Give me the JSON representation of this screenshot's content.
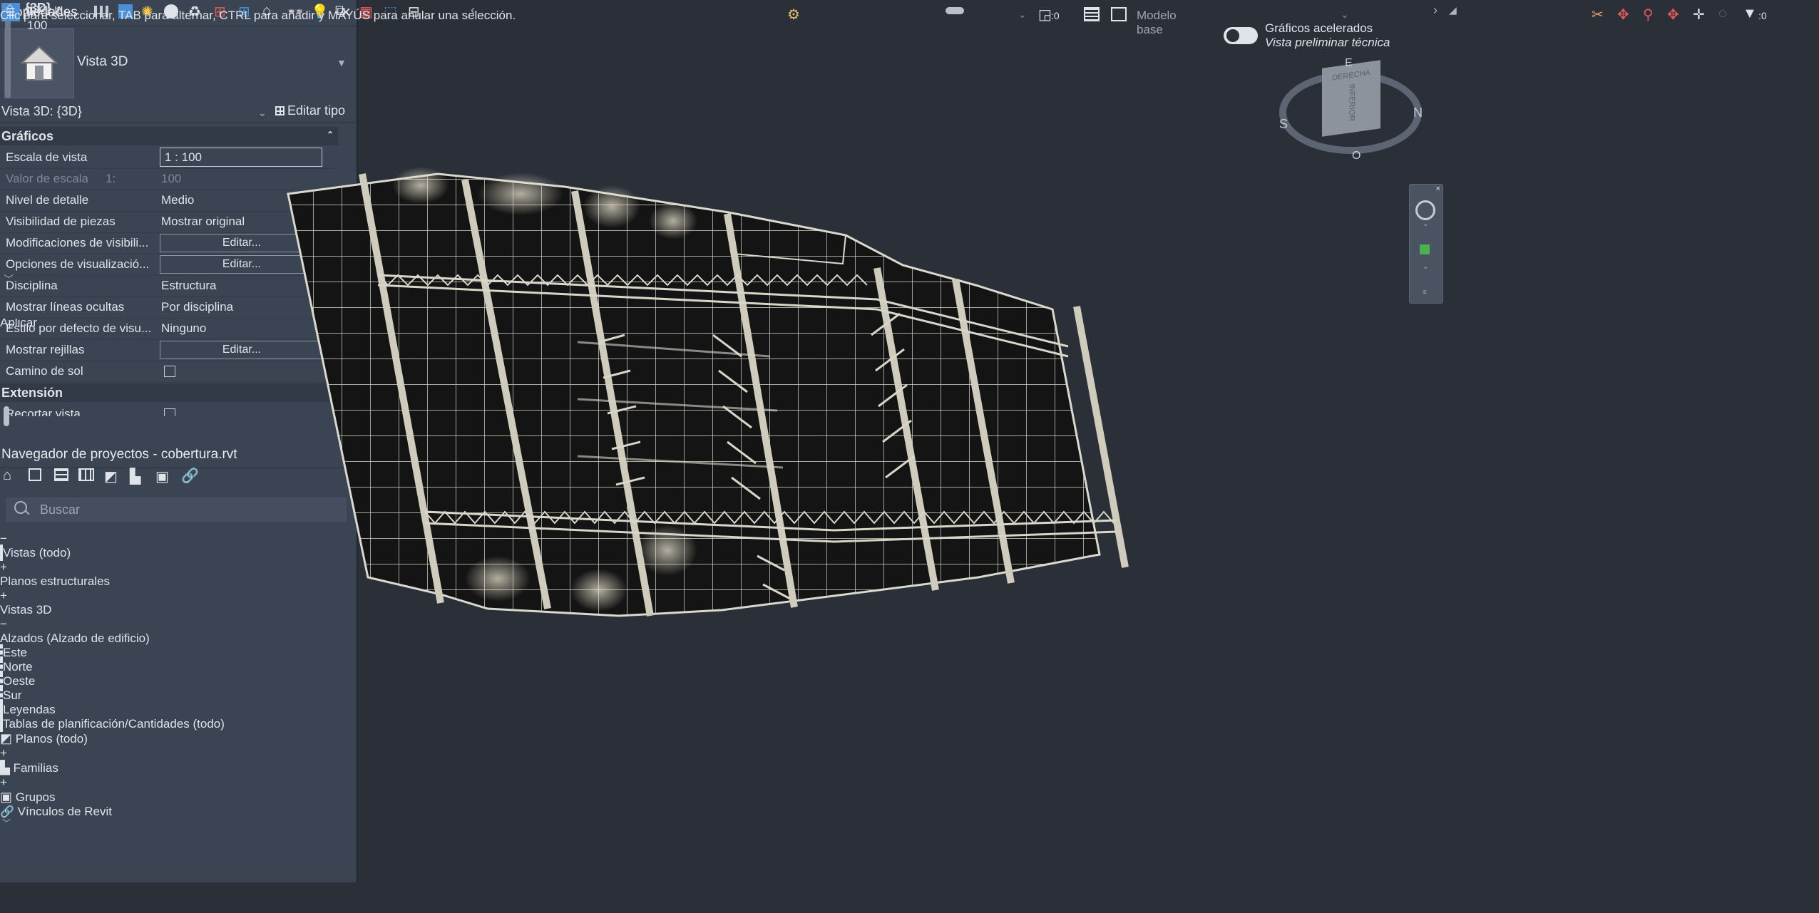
{
  "properties": {
    "title": "Propiedades",
    "type_name": "Vista 3D",
    "instance_label": "Vista 3D: {3D}",
    "edit_type": "Editar tipo",
    "groups": {
      "graphics": "Gráficos",
      "extent": "Extensión"
    },
    "rows": [
      {
        "name": "Escala de vista",
        "value": "1 : 100"
      },
      {
        "name": "Valor de escala",
        "scale_prefix": "1:",
        "value": "100"
      },
      {
        "name": "Nivel de detalle",
        "value": "Medio"
      },
      {
        "name": "Visibilidad de piezas",
        "value": "Mostrar original"
      },
      {
        "name": "Modificaciones de visibili...",
        "value": "Editar..."
      },
      {
        "name": "Opciones de visualizació...",
        "value": "Editar..."
      },
      {
        "name": "Disciplina",
        "value": "Estructura"
      },
      {
        "name": "Mostrar líneas ocultas",
        "value": "Por disciplina"
      },
      {
        "name": "Estilo por defecto de visu...",
        "value": "Ninguno"
      },
      {
        "name": "Mostrar rejillas",
        "value": "Editar..."
      },
      {
        "name": "Camino de sol",
        "value": ""
      }
    ],
    "extent_rows": [
      {
        "name": "Recortar vista"
      }
    ],
    "apply": "Aplicar"
  },
  "browser": {
    "title": "Navegador de proyectos - cobertura.rvt",
    "search_placeholder": "Buscar",
    "tree": {
      "views_all": "Vistas (todo)",
      "structural_plans": "Planos estructurales",
      "views_3d": "Vistas 3D",
      "elevations": "Alzados (Alzado de edificio)",
      "east": "Este",
      "north": "Norte",
      "west": "Oeste",
      "south": "Sur",
      "legends": "Leyendas",
      "schedules": "Tablas de planificación/Cantidades (todo)",
      "sheets": "Planos (todo)",
      "families": "Familias",
      "groups": "Grupos",
      "links": "Vínculos de Revit"
    }
  },
  "tabs": {
    "active": "{3D}"
  },
  "viewport": {
    "accel_label": "Gráficos acelerados",
    "accel_sub": "Vista preliminar técnica",
    "viewcube": {
      "face_front": "DERECHA",
      "face_bottom": "INFERIOR",
      "compass_n": "N",
      "compass_s": "S",
      "compass_e": "E",
      "compass_o": "O"
    }
  },
  "view_bar": {
    "scale": "1 : 100"
  },
  "status": {
    "message": "Clic para seleccionar, TAB para alternar, CTRL para añadir y MAYÚS para anular una selección.",
    "zero_a": ":0",
    "model": "Modelo base",
    "filter_count": ":0"
  },
  "colors": {
    "panel": "#3b4453",
    "viewport": "#2b2f38",
    "accent": "#4a90d9"
  }
}
